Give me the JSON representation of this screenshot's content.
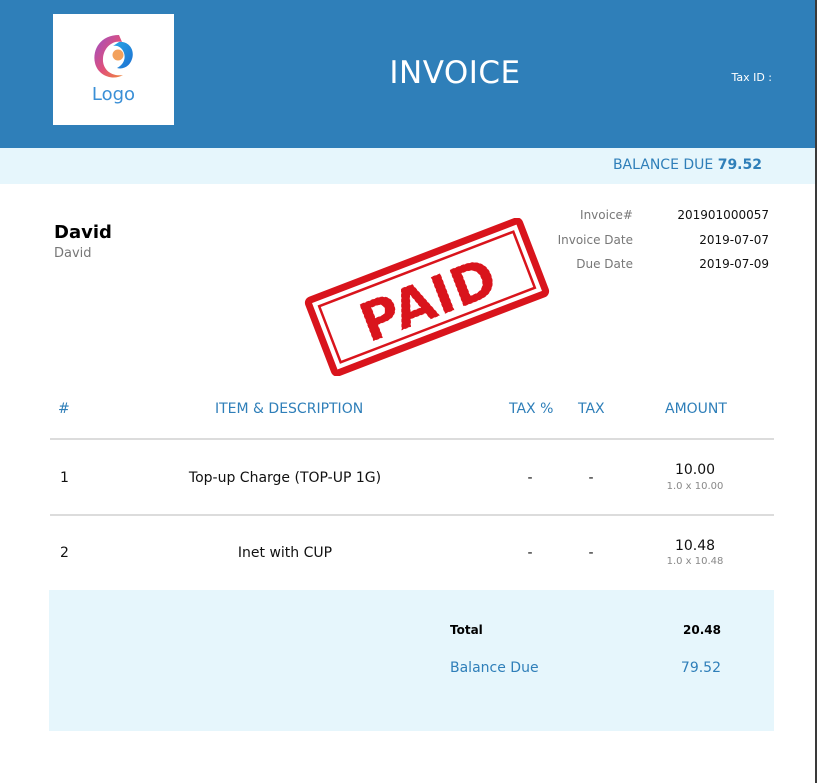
{
  "header": {
    "logo_text": "Logo",
    "title": "INVOICE",
    "tax_id_label": "Tax ID :"
  },
  "balance_banner": {
    "label": "BALANCE DUE",
    "amount": "79.52"
  },
  "customer": {
    "name": "David",
    "subtitle": "David"
  },
  "meta": {
    "invoice_no_label": "Invoice#",
    "invoice_no": "201901000057",
    "invoice_date_label": "Invoice Date",
    "invoice_date": "2019-07-07",
    "due_date_label": "Due Date",
    "due_date": "2019-07-09"
  },
  "stamp": {
    "text": "PAID",
    "color": "#d9141c"
  },
  "table": {
    "headers": [
      "#",
      "ITEM & DESCRIPTION",
      "TAX %",
      "TAX",
      "AMOUNT"
    ],
    "rows": [
      {
        "no": "1",
        "item": "Top-up Charge (TOP-UP 1G)",
        "tax_pct": "-",
        "tax": "-",
        "amount": "10.00",
        "detail": "1.0 x 10.00"
      },
      {
        "no": "2",
        "item": "Inet with CUP",
        "tax_pct": "-",
        "tax": "-",
        "amount": "10.48",
        "detail": "1.0 x 10.48"
      }
    ]
  },
  "summary": {
    "total_label": "Total",
    "total_value": "20.48",
    "balance_label": "Balance Due",
    "balance_value": "79.52"
  },
  "colors": {
    "header_bg": "#2f7fb9",
    "band_bg": "#e6f6fc",
    "accent": "#2f7fb9"
  }
}
